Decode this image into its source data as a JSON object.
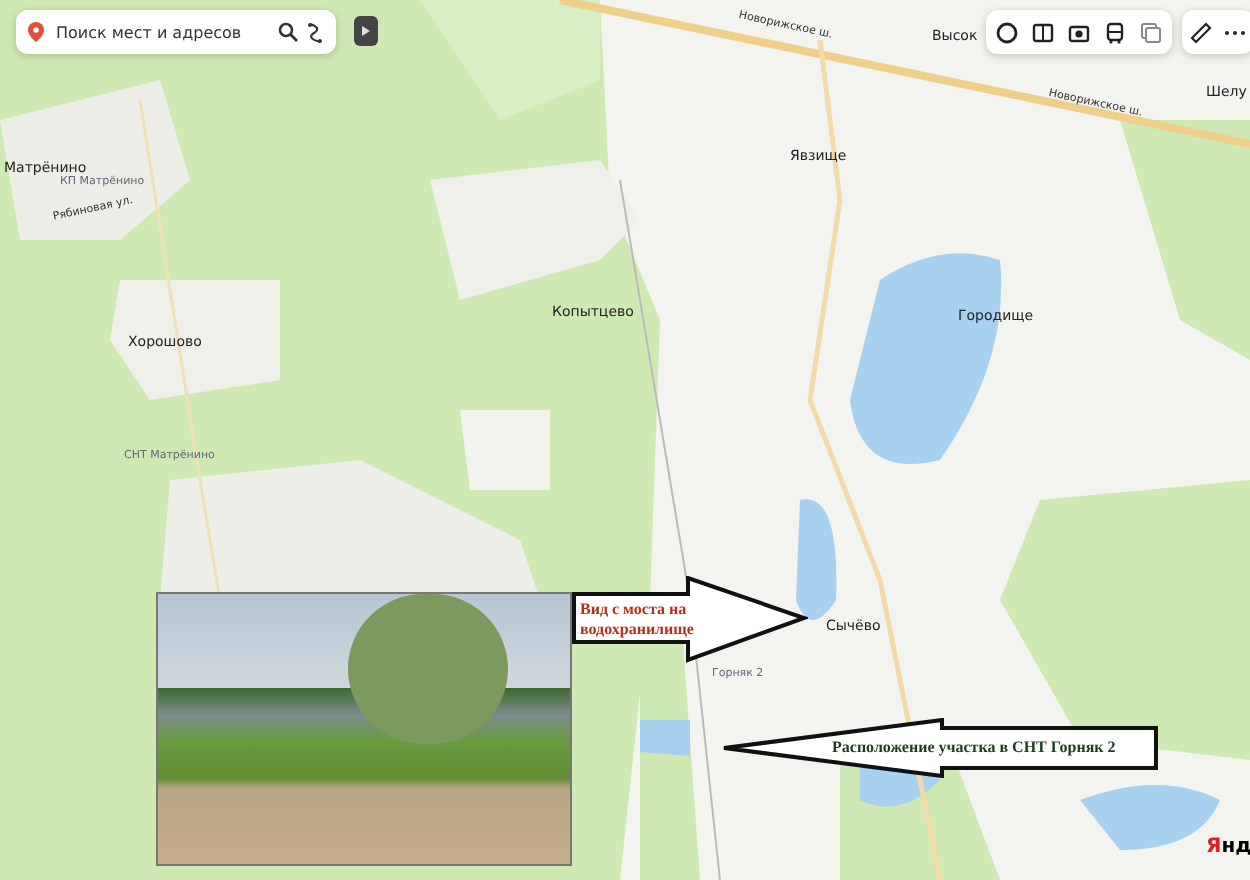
{
  "search": {
    "placeholder": "Поиск мест и адресов"
  },
  "place_labels": [
    {
      "text": "Матрёнино",
      "kind": "place"
    },
    {
      "text": "КП Матрёнино",
      "kind": "minor"
    },
    {
      "text": "Рябиновая ул.",
      "kind": "street"
    },
    {
      "text": "Хорошово",
      "kind": "place"
    },
    {
      "text": "Копытцево",
      "kind": "place"
    },
    {
      "text": "Явзище",
      "kind": "place"
    },
    {
      "text": "Городище",
      "kind": "place"
    },
    {
      "text": "Сычёво",
      "kind": "place"
    },
    {
      "text": "Высок",
      "kind": "place"
    },
    {
      "text": "Шелу",
      "kind": "place"
    },
    {
      "text": "Новорижское ш.",
      "kind": "road"
    },
    {
      "text": "Новорижское ш.",
      "kind": "road"
    },
    {
      "text": "СНТ Матрёнино",
      "kind": "minor"
    },
    {
      "text": "Горняк 2",
      "kind": "minor"
    }
  ],
  "callouts": [
    {
      "text": "Вид с моста на водохранилище",
      "kind": "right",
      "color": "#b5301c"
    },
    {
      "text": "Расположение участка в СНТ Горняк 2",
      "kind": "left",
      "color": "#1f3a1f"
    }
  ],
  "logo": "Янд"
}
